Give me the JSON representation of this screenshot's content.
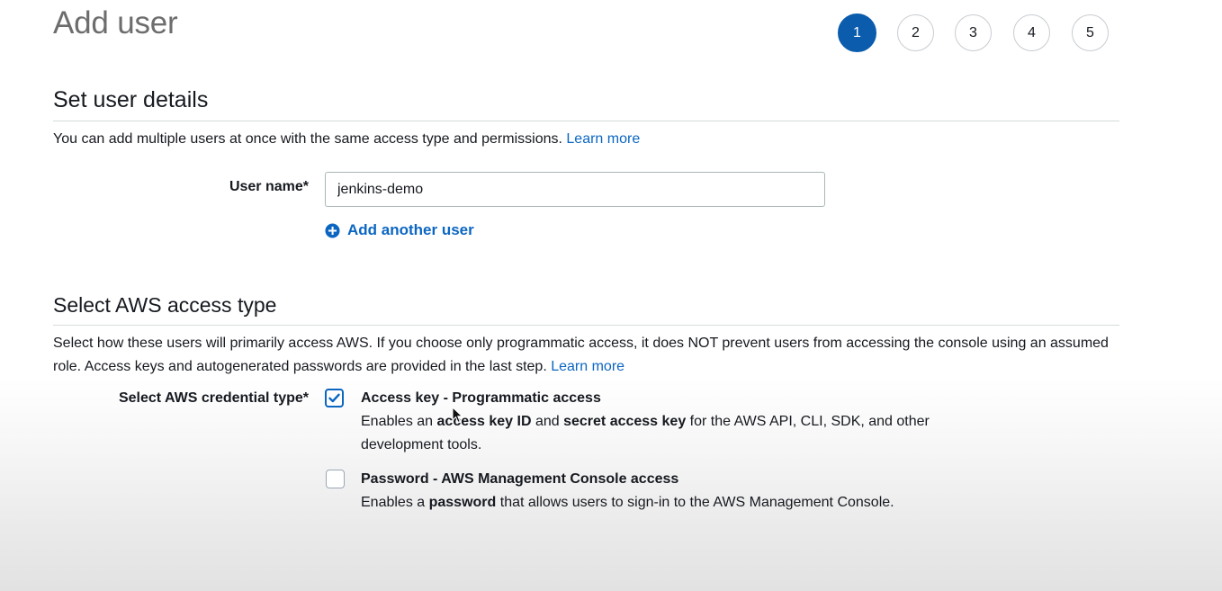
{
  "header": {
    "title": "Add user",
    "steps": [
      "1",
      "2",
      "3",
      "4",
      "5"
    ],
    "active_step": "1"
  },
  "user_details": {
    "heading": "Set user details",
    "description": "You can add multiple users at once with the same access type and permissions.",
    "learn_more": "Learn more",
    "user_name_label": "User name*",
    "user_name_value": "jenkins-demo",
    "add_another_user": "Add another user"
  },
  "access_type": {
    "heading": "Select AWS access type",
    "description": "Select how these users will primarily access AWS. If you choose only programmatic access, it does NOT prevent users from accessing the console using an assumed role. Access keys and autogenerated passwords are provided in the last step.",
    "learn_more": "Learn more",
    "credential_label": "Select AWS credential type*",
    "options": [
      {
        "title": "Access key - Programmatic access",
        "checked": true,
        "desc_parts": [
          "Enables an ",
          "access key ID",
          " and ",
          "secret access key",
          " for the AWS API, CLI, SDK, and other development tools."
        ]
      },
      {
        "title": "Password - AWS Management Console access",
        "checked": false,
        "desc_parts": [
          "Enables a ",
          "password",
          " that allows users to sign-in to the AWS Management Console."
        ]
      }
    ]
  },
  "colors": {
    "accent": "#0b5cad",
    "link": "#0b66c2",
    "text": "#16191f",
    "title_gray": "#6d6d6d"
  },
  "icons": {
    "add": "plus-circle-icon",
    "check": "checkmark-icon",
    "pointer": "mouse-pointer-icon"
  }
}
